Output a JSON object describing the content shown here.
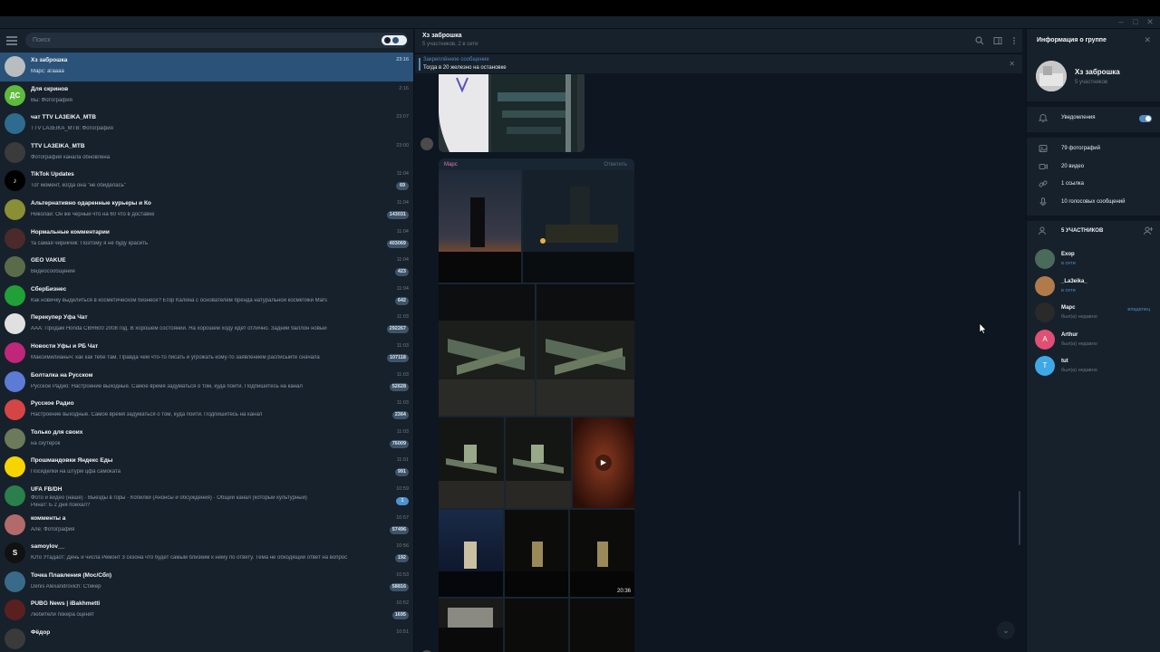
{
  "window": {
    "minimize": "–",
    "maximize": "□",
    "close": "✕"
  },
  "left": {
    "search_placeholder": "Поиск",
    "chats": [
      {
        "name": "Хз заброшка",
        "preview": "Марс: агаааа",
        "time": "23:16",
        "badge": "",
        "avatar": "photo-grey",
        "initials": ""
      },
      {
        "name": "Для скринов",
        "preview": "Вы: Фотография",
        "time": "2:16",
        "badge": "",
        "avatar": "#5fba3c",
        "initials": "ДС"
      },
      {
        "name": "чат TTV LA3EIKA_MTB",
        "preview": "TTV LA3EIKA_MTB: Фотография",
        "time": "23:07",
        "badge": "",
        "avatar": "#2d6c8e",
        "initials": ""
      },
      {
        "name": "TTV LA3EIKA_MTB",
        "preview": "Фотография канала обновлена",
        "time": "23:00",
        "badge": "",
        "avatar": "#3b3b3b",
        "initials": ""
      },
      {
        "name": "TikTok Updates",
        "preview": "Тот момент, когда она \"не обиделась\"",
        "time": "11:04",
        "badge": "69",
        "avatar": "#000000",
        "initials": "♪"
      },
      {
        "name": "Альтернативно одаренные курьеры и Ко",
        "preview": "Николай: Он же черный что на 60 что в доставке",
        "time": "11:04",
        "badge": "143031",
        "avatar": "#8a8f36",
        "initials": ""
      },
      {
        "name": "Нормальные комментарии",
        "preview": "та самая чирикчик: Поэтому я не буду красить",
        "time": "11:04",
        "badge": "403069",
        "avatar": "#4a2a2a",
        "initials": ""
      },
      {
        "name": "GEO VAKUE",
        "preview": "Видеосообщение",
        "time": "11:04",
        "badge": "423",
        "avatar": "#5a6b4a",
        "initials": ""
      },
      {
        "name": "СберБизнес",
        "preview": "Как новичку выделиться в косметическом бизнесе? Егор Калина с основателем бренда натуральной косметики Mars",
        "time": "11:04",
        "badge": "642",
        "avatar": "#21a038",
        "initials": ""
      },
      {
        "name": "Перекупер Уфа Чат",
        "preview": "ААА: Продам Honda CBR600 2008 год. В хорошем состоянии. На хорошем ходу идет отлично. Задний баллон новый",
        "time": "11:03",
        "badge": "292267",
        "avatar": "#e0e0e0",
        "initials": ""
      },
      {
        "name": "Новости Уфы и РБ Чат",
        "preview": "Максимилианыч: как как тебе там. Правда чем что-то писать и угрожать кому-то заявлением расписыйте сначала",
        "time": "11:03",
        "badge": "107118",
        "avatar": "#c0267a",
        "initials": ""
      },
      {
        "name": "Болталка на Русском",
        "preview": "Русское Радио: Настроение выходные. Самое время задуматься о том, куда пойти. Подпишитесь на канал",
        "time": "11:03",
        "badge": "52628",
        "avatar": "#5c7bd6",
        "initials": ""
      },
      {
        "name": "Русское Радио",
        "preview": "Настроение выходные. Самое время задуматься о том, куда пойти. Подпишитесь на канал",
        "time": "11:03",
        "badge": "2364",
        "avatar": "#d64545",
        "initials": ""
      },
      {
        "name": "Только для своих",
        "preview": "на скутерок",
        "time": "11:03",
        "badge": "76009",
        "avatar": "#6a7a5a",
        "initials": ""
      },
      {
        "name": "Прошмандовки Яндекс Еды",
        "preview": "Посиделки на штурм цфа самоката",
        "time": "11:01",
        "badge": "991",
        "avatar": "#f5d400",
        "initials": ""
      },
      {
        "name": "UFA FB/DH",
        "preview": "Фото и видео (наше) · Выезды в горы · Копилки (Анонсы и обсуждения) · Общий канал (который культурный)",
        "preview2": "Ринат: Б 2 дня поехал?",
        "time": "10:59",
        "badge": "1",
        "badgeBlue": true,
        "avatar": "#2a7f4a",
        "initials": ""
      },
      {
        "name": "комменты а",
        "preview": "Але: Фотография",
        "time": "10:57",
        "badge": "57496",
        "avatar": "#b36a6a",
        "initials": ""
      },
      {
        "name": "samoylov__",
        "preview": "Юто Утадаот: День и числа Ремонт 3 сезона что будет самым близким к нему по ответу. Тема не обходящий ответ на вопрос",
        "time": "10:56",
        "badge": "192",
        "avatar": "#111111",
        "initials": "S"
      },
      {
        "name": "Точка Плавления (Moс/Cбп)",
        "preview": "Denis Alexandrovich: Стикер",
        "time": "10:53",
        "badge": "58816",
        "avatar": "#3a6a8a",
        "initials": ""
      },
      {
        "name": "PUBG News | iBakhmetti",
        "preview": "Любители покера оценят",
        "time": "10:52",
        "badge": "1695",
        "avatar": "#5a2020",
        "initials": ""
      },
      {
        "name": "Фёдор",
        "preview": "",
        "time": "10:51",
        "badge": "",
        "avatar": "#3a3a3a",
        "initials": ""
      }
    ]
  },
  "middle": {
    "title": "Хз заброшка",
    "subtitle": "5 участников, 2 в сети",
    "pinned_title": "Закреплённое сообщение",
    "pinned_text": "Тогда в 20 железно на остановке",
    "sender": "Марс",
    "reply_label": "Ответить",
    "video_time": "20:36",
    "play_icon": "play-icon",
    "scroll_icon": "chevron-down-icon"
  },
  "right": {
    "title": "Информация о группе",
    "group_name": "Хз заброшка",
    "group_sub": "5 участников",
    "notifications_label": "Уведомления",
    "notifications_on": true,
    "media": [
      {
        "icon": "photo-icon",
        "label": "79 фотографий"
      },
      {
        "icon": "video-icon",
        "label": "20 видео"
      },
      {
        "icon": "link-icon",
        "label": "1 ссылка"
      },
      {
        "icon": "mic-icon",
        "label": "10 голосовых сообщений"
      }
    ],
    "members_header": "5 УЧАСТНИКОВ",
    "members": [
      {
        "name": "Exop",
        "status": "в сети",
        "online": true,
        "role": "",
        "color": "#4a6a5a",
        "initial": ""
      },
      {
        "name": "_La3eika_",
        "status": "в сети",
        "online": true,
        "role": "",
        "color": "#b07a4a",
        "initial": ""
      },
      {
        "name": "Марс",
        "status": "был(а) недавно",
        "online": false,
        "role": "владелец",
        "color": "#2a2a2a",
        "initial": ""
      },
      {
        "name": "Arthur",
        "status": "был(а) недавно",
        "online": false,
        "role": "",
        "color": "#e04f74",
        "initial": "A"
      },
      {
        "name": "tut",
        "status": "был(а) недавно",
        "online": false,
        "role": "",
        "color": "#3fa9e8",
        "initial": "T"
      }
    ]
  },
  "colors": {
    "accent": "#5288c1",
    "active_chat": "#2b5278",
    "bg_dark": "#0e1621",
    "panel": "#17212b"
  }
}
